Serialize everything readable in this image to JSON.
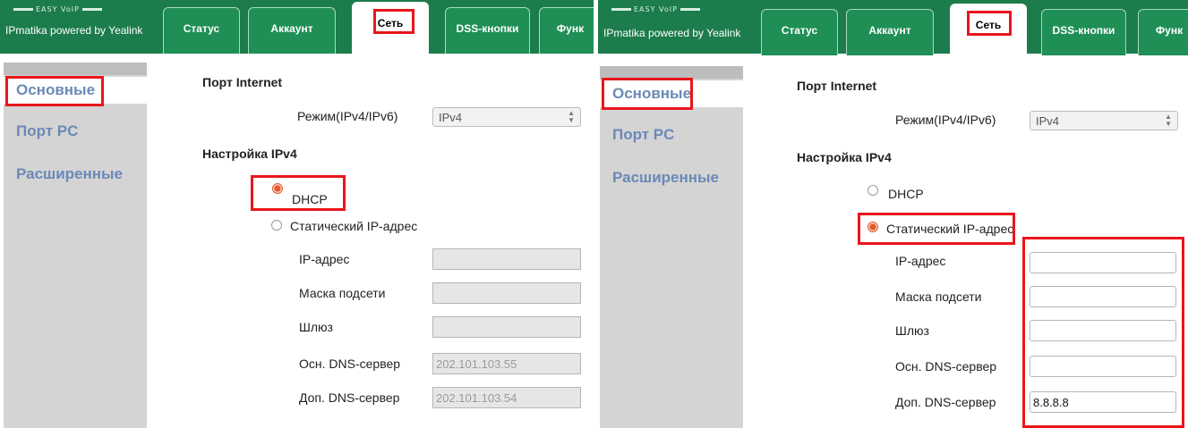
{
  "header": {
    "brand_top": "EASY VoIP",
    "brand": "IPmatika powered by Yealink",
    "tabs": [
      "Статус",
      "Аккаунт",
      "Сеть",
      "DSS-кнопки",
      "Функ"
    ]
  },
  "sidebar": {
    "items": [
      "Основные",
      "Порт PC",
      "Расширенные"
    ]
  },
  "content": {
    "internet_port_title": "Порт Internet",
    "mode_label": "Режим(IPv4/IPv6)",
    "mode_value": "IPv4",
    "ipv4_title": "Настройка IPv4",
    "dhcp_label": "DHCP",
    "static_label": "Статический IP-адрес",
    "field_labels": [
      "IP-адрес",
      "Маска подсети",
      "Шлюз",
      "Осн. DNS-сервер",
      "Доп. DNS-сервер"
    ]
  },
  "left": {
    "selected_mode": "DHCP",
    "fields": [
      "",
      "",
      "",
      "202.101.103.55",
      "202.101.103.54"
    ]
  },
  "right": {
    "selected_mode": "Статический IP-адрес",
    "fields": [
      "",
      "",
      "",
      "",
      "8.8.8.8"
    ]
  },
  "colors": {
    "header": "#1c7c4c",
    "sidebar": "#d4d4d4",
    "sidebar_text": "#6b89b7",
    "highlight": "#e8161b",
    "radio_selected": "#e05a2a"
  }
}
